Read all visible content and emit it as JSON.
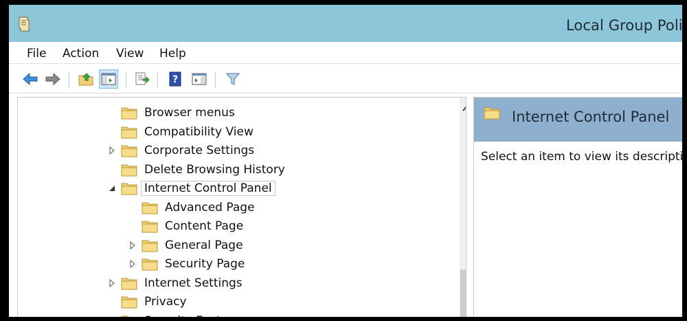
{
  "window": {
    "title": "Local Group Polic"
  },
  "menu": [
    "File",
    "Action",
    "View",
    "Help"
  ],
  "toolbar": {
    "buttons": [
      "back-icon",
      "forward-icon",
      "up-folder-icon",
      "show-hide-tree-icon",
      "export-list-icon",
      "help-icon",
      "show-hide-action-pane-icon",
      "filter-icon"
    ]
  },
  "tree": {
    "items": [
      {
        "label": "Browser menus",
        "expander": "none"
      },
      {
        "label": "Compatibility View",
        "expander": "none"
      },
      {
        "label": "Corporate Settings",
        "expander": "collapsed"
      },
      {
        "label": "Delete Browsing History",
        "expander": "none"
      },
      {
        "label": "Internet Control Panel",
        "expander": "expanded",
        "selected": true
      },
      {
        "label": "Advanced Page",
        "expander": "none"
      },
      {
        "label": "Content Page",
        "expander": "none"
      },
      {
        "label": "General Page",
        "expander": "collapsed"
      },
      {
        "label": "Security Page",
        "expander": "collapsed"
      },
      {
        "label": "Internet Settings",
        "expander": "collapsed"
      },
      {
        "label": "Privacy",
        "expander": "none"
      },
      {
        "label": "Security Features",
        "expander": "collapsed"
      }
    ]
  },
  "details": {
    "header": "Internet Control Panel",
    "description": "Select an item to view its description."
  },
  "colors": {
    "titlebar": "#8dc6d8",
    "details_header": "#8fafcf",
    "folder": "#f2d07a"
  }
}
